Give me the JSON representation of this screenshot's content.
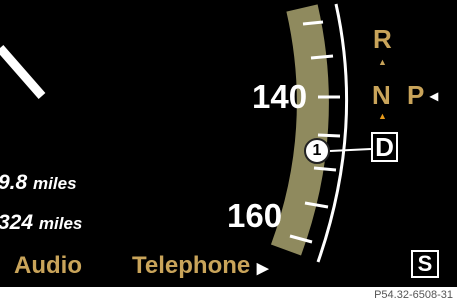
{
  "speedometer": {
    "marks": [
      "140",
      "160"
    ]
  },
  "trip": {
    "line1_value": "9.8",
    "line1_unit": "miles",
    "line2_value": "324",
    "line2_unit": "miles"
  },
  "menu": {
    "audio": "Audio",
    "telephone": "Telephone",
    "arrow": "▶"
  },
  "gears": {
    "r": "R",
    "n": "N",
    "p": "P",
    "d": "D",
    "up_arrow": "▲",
    "left_arrow": "◂"
  },
  "callout": "1",
  "s_button": "S",
  "figure_ref": "P54.32-6508-31",
  "colors": {
    "background": "#000000",
    "accent": "#c9a45a",
    "scale_band": "#8f8a5e",
    "gear_selected_arrow": "#e89a1a"
  },
  "icons": {
    "needle": "needle-icon",
    "gear_arrow": "triangle-up-icon",
    "menu_arrow": "triangle-right-icon"
  }
}
